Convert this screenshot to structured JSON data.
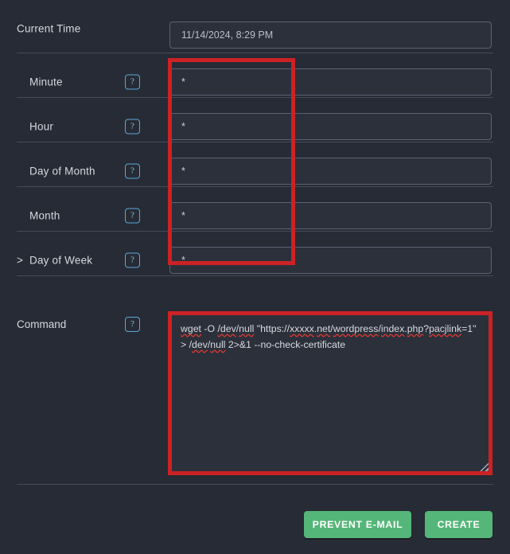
{
  "colors": {
    "background": "#272b35",
    "field_background": "#2c303b",
    "field_border": "#5b6273",
    "divider": "#454b58",
    "label_text": "#d5d8de",
    "help_icon_border": "#5aa9d6",
    "help_icon_text": "#7dc1e3",
    "annotation_red": "#cc2225",
    "button_green": "#54b678",
    "button_text": "#ffffff",
    "spellcheck_red": "#e03a32"
  },
  "current_time": {
    "label": "Current Time",
    "value": "11/14/2024, 8:29 PM"
  },
  "help_icon_glyph": "?",
  "cron_fields": [
    {
      "caret": "",
      "label": "Minute",
      "value": "*",
      "help": "?"
    },
    {
      "caret": "",
      "label": "Hour",
      "value": "*",
      "help": "?"
    },
    {
      "caret": "",
      "label": "Day of Month",
      "value": "*",
      "help": "?"
    },
    {
      "caret": "",
      "label": "Month",
      "value": "*",
      "help": "?"
    },
    {
      "caret": ">",
      "label": "Day of Week",
      "value": "*",
      "help": "?"
    }
  ],
  "command": {
    "label": "Command",
    "help": "?",
    "line1_a": "wget",
    "line1_b": " -O ",
    "line1_c": "/dev",
    "line1_d": "/",
    "line1_e": "null",
    "line1_f": " \"https://",
    "line1_g": "xxxxx",
    "line1_h": ".",
    "line1_i": "net",
    "line1_j": "/",
    "line1_k": "wordpress",
    "line1_l": "/",
    "line1_m": "index",
    "line1_n": ".",
    "line1_o": "php",
    "line1_p": "?",
    "line2_a": "pacjlink",
    "line2_b": "=1\" > /",
    "line2_c": "dev",
    "line2_d": "/",
    "line2_e": "null",
    "line2_f": " 2>&1 --no-check-certificate",
    "full_value": "wget -O /dev/null \"https://xxxxx.net/wordpress/index.php?pacjlink=1\" > /dev/null 2>&1 --no-check-certificate"
  },
  "footer": {
    "prevent_email_label": "PREVENT E-MAIL",
    "create_label": "CREATE"
  },
  "annotations": [
    {
      "name": "cron-fields-highlight",
      "color": "#cc2225"
    },
    {
      "name": "command-field-highlight",
      "color": "#cc2225"
    }
  ]
}
